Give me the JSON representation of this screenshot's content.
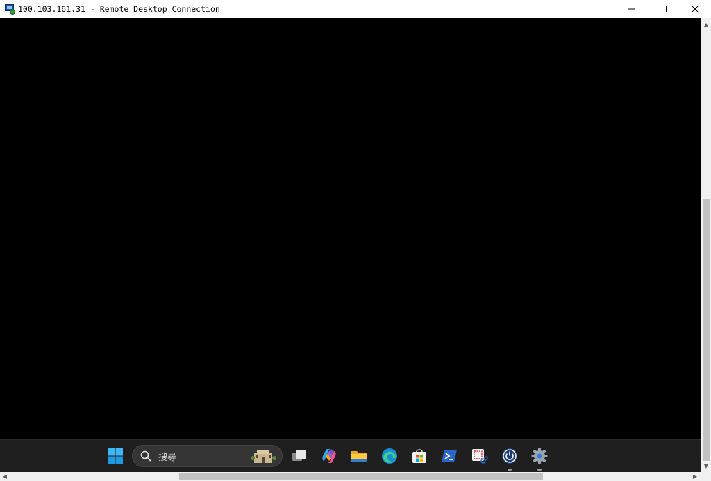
{
  "window": {
    "title": "100.103.161.31 - Remote Desktop Connection",
    "icon": "remote-desktop-icon"
  },
  "controls": {
    "minimize": "minimize-icon",
    "maximize": "maximize-icon",
    "close": "close-icon"
  },
  "taskbar": {
    "search_placeholder": "搜尋",
    "items": [
      {
        "name": "start-button",
        "icon": "windows-logo-icon"
      },
      {
        "name": "search-box",
        "icon": "search-icon"
      },
      {
        "name": "task-view-button",
        "icon": "task-view-icon"
      },
      {
        "name": "copilot-button",
        "icon": "copilot-icon"
      },
      {
        "name": "file-explorer-button",
        "icon": "folder-icon"
      },
      {
        "name": "edge-button",
        "icon": "edge-icon"
      },
      {
        "name": "microsoft-store-button",
        "icon": "store-icon"
      },
      {
        "name": "powershell-button",
        "icon": "powershell-icon"
      },
      {
        "name": "snipping-tool-button",
        "icon": "snipping-tool-icon"
      },
      {
        "name": "power-app-button",
        "icon": "power-icon",
        "running": true
      },
      {
        "name": "settings-button",
        "icon": "gear-icon",
        "running": true
      }
    ]
  },
  "colors": {
    "remote_background": "#000000",
    "taskbar": "#1f1f1f",
    "scrollbar": "#f0f0f0",
    "scroll_thumb": "#c2c2c2"
  }
}
